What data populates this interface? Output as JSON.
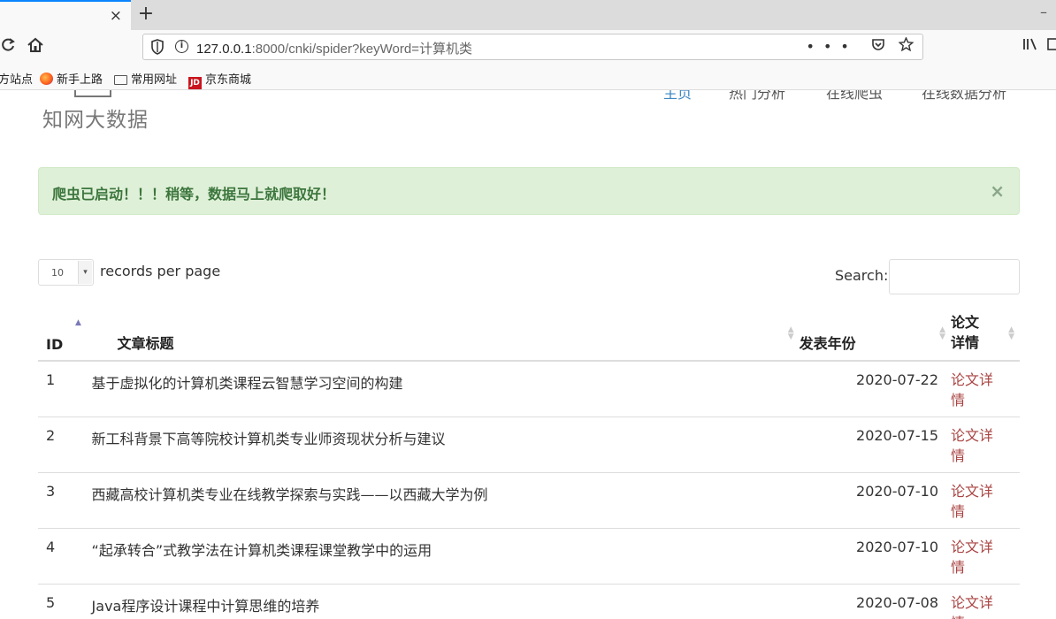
{
  "browser": {
    "tab_close": "×",
    "new_tab": "+",
    "minimize": "–",
    "url_host": "127.0.0.1",
    "url_path": ":8000/cnki/spider?keyWord=计算机类",
    "url_actions": "•••",
    "bookmarks": [
      {
        "label": "方站点",
        "icon": "none"
      },
      {
        "label": "新手上路",
        "icon": "firefox-icon"
      },
      {
        "label": "常用网址",
        "icon": "folder-icon"
      },
      {
        "label": "京东商城",
        "icon": "jd-icon"
      }
    ],
    "jd_icon_text": "JD"
  },
  "header": {
    "site_title": "知网大数据",
    "nav": [
      "主页",
      "热门分析",
      "在线爬虫",
      "在线数据分析"
    ]
  },
  "alert": {
    "message": "爬虫已启动！！！稍等，数据马上就爬取好！",
    "close": "×"
  },
  "table_controls": {
    "page_length": "10",
    "length_label": "records per page",
    "search_label": "Search:",
    "search_value": ""
  },
  "table": {
    "headers": {
      "id": "ID",
      "title": "文章标题",
      "year": "发表年份",
      "detail_line1": "论文",
      "detail_line2": "详情"
    },
    "rows": [
      {
        "id": "1",
        "title": "基于虚拟化的计算机类课程云智慧学习空间的构建",
        "date": "2020-07-22",
        "link": "论文详情"
      },
      {
        "id": "2",
        "title": "新工科背景下高等院校计算机类专业师资现状分析与建议",
        "date": "2020-07-15",
        "link": "论文详情"
      },
      {
        "id": "3",
        "title": "西藏高校计算机类专业在线教学探索与实践——以西藏大学为例",
        "date": "2020-07-10",
        "link": "论文详情"
      },
      {
        "id": "4",
        "title": "“起承转合”式教学法在计算机类课程课堂教学中的运用",
        "date": "2020-07-10",
        "link": "论文详情"
      },
      {
        "id": "5",
        "title": "Java程序设计课程中计算思维的培养",
        "date": "2020-07-08",
        "link": "论文详情"
      }
    ]
  },
  "colors": {
    "alert_bg": "#dff0d8",
    "alert_text": "#3c763d",
    "link": "#a94442",
    "active_nav": "#3a86c4"
  }
}
